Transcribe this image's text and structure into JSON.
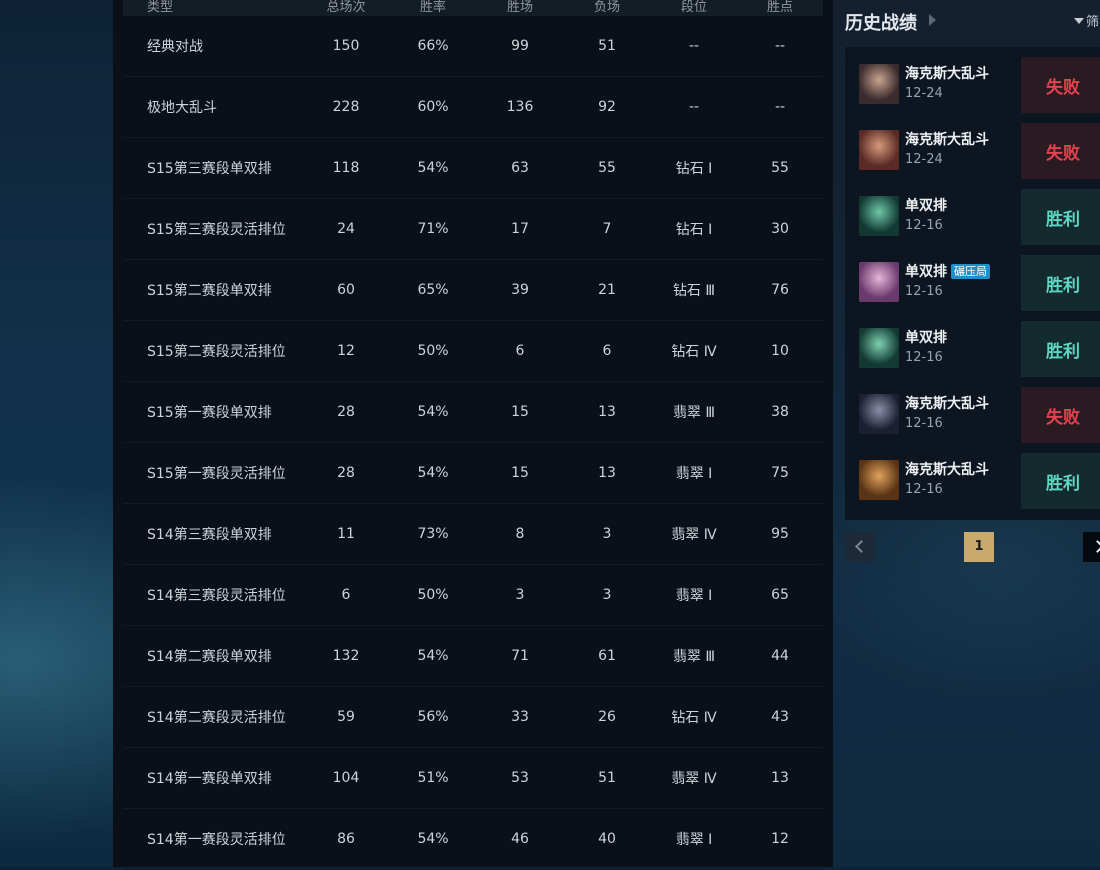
{
  "stats": {
    "headers": [
      "类型",
      "总场次",
      "胜率",
      "胜场",
      "负场",
      "段位",
      "胜点"
    ],
    "rows": [
      [
        "经典对战",
        "150",
        "66%",
        "99",
        "51",
        "--",
        "--"
      ],
      [
        "极地大乱斗",
        "228",
        "60%",
        "136",
        "92",
        "--",
        "--"
      ],
      [
        "S15第三赛段单双排",
        "118",
        "54%",
        "63",
        "55",
        "钻石 Ⅰ",
        "55"
      ],
      [
        "S15第三赛段灵活排位",
        "24",
        "71%",
        "17",
        "7",
        "钻石 Ⅰ",
        "30"
      ],
      [
        "S15第二赛段单双排",
        "60",
        "65%",
        "39",
        "21",
        "钻石 Ⅲ",
        "76"
      ],
      [
        "S15第二赛段灵活排位",
        "12",
        "50%",
        "6",
        "6",
        "钻石 Ⅳ",
        "10"
      ],
      [
        "S15第一赛段单双排",
        "28",
        "54%",
        "15",
        "13",
        "翡翠 Ⅲ",
        "38"
      ],
      [
        "S15第一赛段灵活排位",
        "28",
        "54%",
        "15",
        "13",
        "翡翠 Ⅰ",
        "75"
      ],
      [
        "S14第三赛段单双排",
        "11",
        "73%",
        "8",
        "3",
        "翡翠 Ⅳ",
        "95"
      ],
      [
        "S14第三赛段灵活排位",
        "6",
        "50%",
        "3",
        "3",
        "翡翠 Ⅰ",
        "65"
      ],
      [
        "S14第二赛段单双排",
        "132",
        "54%",
        "71",
        "61",
        "翡翠 Ⅲ",
        "44"
      ],
      [
        "S14第二赛段灵活排位",
        "59",
        "56%",
        "33",
        "26",
        "钻石 Ⅳ",
        "43"
      ],
      [
        "S14第一赛段单双排",
        "104",
        "51%",
        "53",
        "51",
        "翡翠 Ⅳ",
        "13"
      ],
      [
        "S14第一赛段灵活排位",
        "86",
        "54%",
        "46",
        "40",
        "翡翠 Ⅰ",
        "12"
      ]
    ]
  },
  "history": {
    "title": "历史战绩",
    "filter_label": "筛",
    "matches": [
      {
        "mode": "海克斯大乱斗",
        "date": "12-24",
        "result": "失败",
        "outcome": "loss",
        "badge": "",
        "avatar": "champion-avatar",
        "colors": [
          "#3a2b2e",
          "#c9a58e"
        ]
      },
      {
        "mode": "海克斯大乱斗",
        "date": "12-24",
        "result": "失败",
        "outcome": "loss",
        "badge": "",
        "avatar": "champion-avatar",
        "colors": [
          "#5a2a26",
          "#d79a7a"
        ]
      },
      {
        "mode": "单双排",
        "date": "12-16",
        "result": "胜利",
        "outcome": "win",
        "badge": "",
        "avatar": "champion-avatar",
        "colors": [
          "#123a33",
          "#6fc7a8"
        ]
      },
      {
        "mode": "单双排",
        "date": "12-16",
        "result": "胜利",
        "outcome": "win",
        "badge": "碾压局",
        "avatar": "champion-avatar",
        "colors": [
          "#6a3a6e",
          "#e7b6d8"
        ]
      },
      {
        "mode": "单双排",
        "date": "12-16",
        "result": "胜利",
        "outcome": "win",
        "badge": "",
        "avatar": "champion-avatar",
        "colors": [
          "#123a33",
          "#7fd0b0"
        ]
      },
      {
        "mode": "海克斯大乱斗",
        "date": "12-16",
        "result": "失败",
        "outcome": "loss",
        "badge": "",
        "avatar": "champion-avatar",
        "colors": [
          "#1d2032",
          "#8a8fa8"
        ]
      },
      {
        "mode": "海克斯大乱斗",
        "date": "12-16",
        "result": "胜利",
        "outcome": "win",
        "badge": "",
        "avatar": "champion-avatar",
        "colors": [
          "#5a3416",
          "#e0a35a"
        ]
      }
    ],
    "pager": {
      "current_page": "1"
    }
  }
}
